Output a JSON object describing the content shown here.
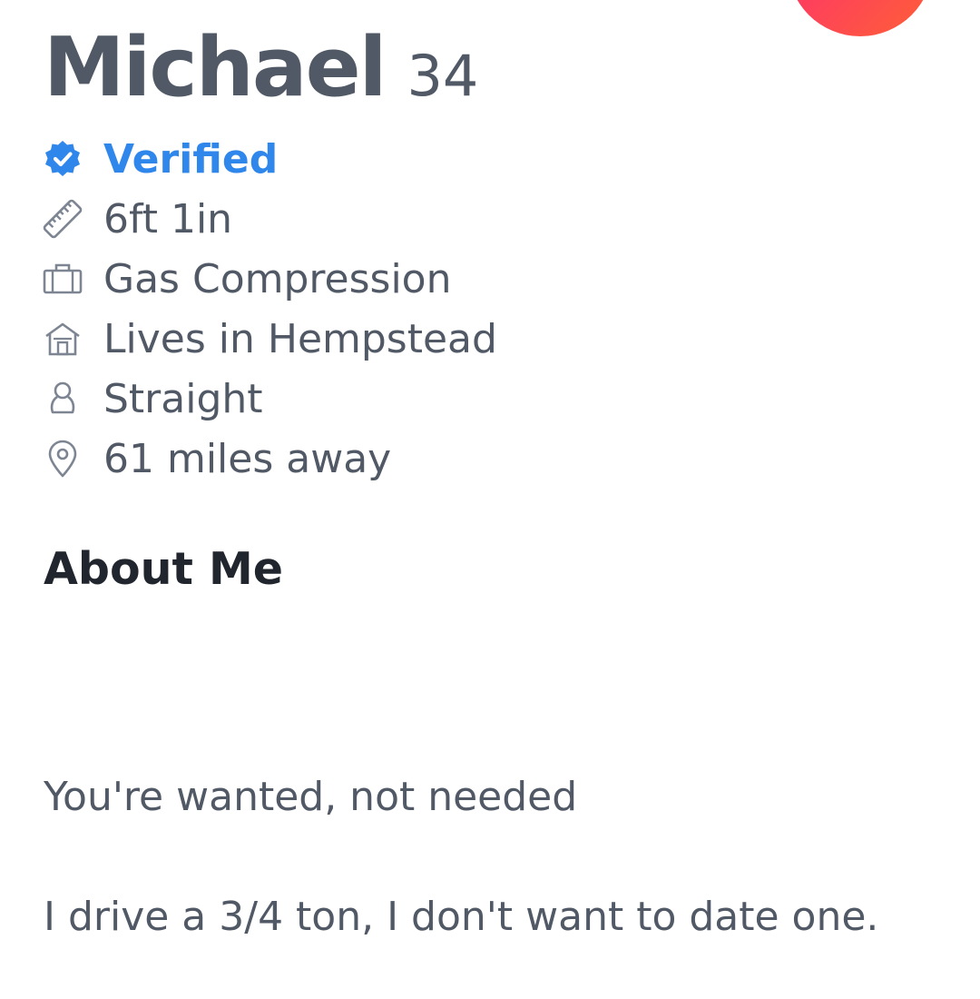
{
  "profile": {
    "name": "Michael",
    "age": "34"
  },
  "info": [
    {
      "icon": "verified-badge-icon",
      "text": "Verified",
      "color": "#2f86eb"
    },
    {
      "icon": "ruler-icon",
      "text": "6ft 1in"
    },
    {
      "icon": "briefcase-icon",
      "text": "Gas Compression"
    },
    {
      "icon": "house-icon",
      "text": "Lives in Hempstead"
    },
    {
      "icon": "person-icon",
      "text": "Straight"
    },
    {
      "icon": "location-pin-icon",
      "text": "61 miles away"
    }
  ],
  "about": {
    "title": "About Me",
    "lines": [
      "You're wanted, not needed",
      "I drive a 3/4 ton, I don't want to date one."
    ]
  },
  "colors": {
    "text": "#505965",
    "heading": "#21262e",
    "verified": "#2f86eb",
    "accent_start": "#fd267a",
    "accent_end": "#ff6036"
  }
}
